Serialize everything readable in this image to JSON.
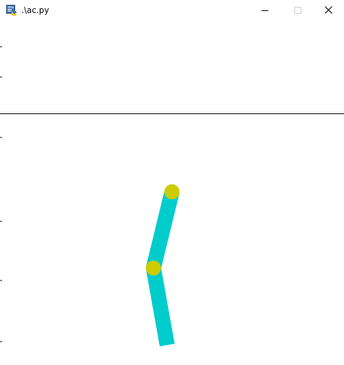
{
  "window": {
    "title": ".\\ac.py",
    "icon": "python-file-icon",
    "controls": {
      "minimize_icon": "minimize-icon",
      "maximize_icon": "maximize-icon",
      "close_icon": "close-icon"
    }
  },
  "scene": {
    "colors": {
      "background": "#ffffff",
      "line": "#000000",
      "link": "#00cccc",
      "joint": "#cccc00"
    }
  }
}
